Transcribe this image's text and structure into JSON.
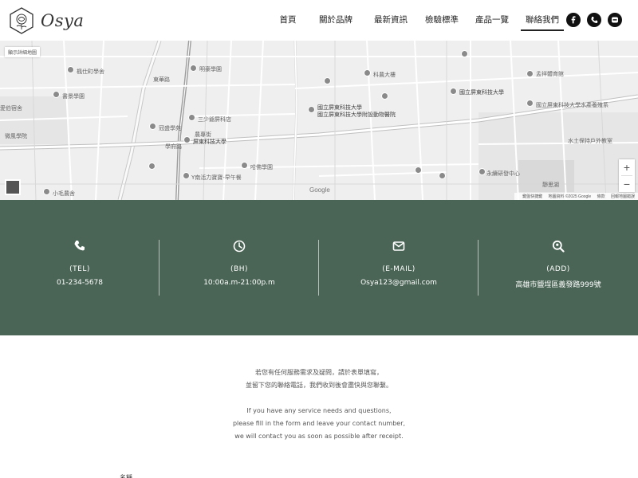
{
  "brand": {
    "name": "Osya"
  },
  "nav": {
    "items": [
      {
        "label": "首頁",
        "name": "nav-home"
      },
      {
        "label": "關於品牌",
        "name": "nav-about"
      },
      {
        "label": "最新資訊",
        "name": "nav-news"
      },
      {
        "label": "檢驗標準",
        "name": "nav-standards"
      },
      {
        "label": "產品一覽",
        "name": "nav-products"
      },
      {
        "label": "聯絡我們",
        "name": "nav-contact"
      }
    ],
    "active": "聯絡我們"
  },
  "socials": [
    {
      "icon": "facebook-icon"
    },
    {
      "icon": "phone-icon"
    },
    {
      "icon": "line-icon"
    }
  ],
  "map": {
    "enlarge_label": "顯示詳細地圖",
    "zoom_in": "+",
    "zoom_out": "−",
    "provider": "Google",
    "attribution": [
      "鍵盤快捷鍵",
      "地圖資料 ©2025 Google",
      "條款",
      "回報地圖錯誤"
    ],
    "labels": [
      "楓仕町學舍",
      "明豪學園",
      "書景學園",
      "三少爺屏科店",
      "冠盛學苑",
      "屏東科技大學",
      "哈佛學園",
      "Y南活力寶寶-早午餐",
      "小毛農舍",
      "微風學院",
      "國立屏東科技大學",
      "國立屏東科技大學附設動物醫院",
      "科農大樓",
      "國立屏東科技大學",
      "孟祥體育館",
      "國立屏東科技大學水產養殖系",
      "水土保持戶外教室",
      "永續研發中心",
      "靜思湖",
      "農專街",
      "學府路",
      "東華路",
      "愛伯宿舍"
    ]
  },
  "contact": [
    {
      "icon": "phone-icon",
      "title": "(TEL)",
      "value": "01-234-5678"
    },
    {
      "icon": "clock-icon",
      "title": "(BH)",
      "value": "10:00a.m-21:00p.m"
    },
    {
      "icon": "mail-icon",
      "title": "(E-MAIL)",
      "value": "Osya123@gmail.com"
    },
    {
      "icon": "search-location-icon",
      "title": "(ADD)",
      "value": "高雄市鹽埕區義發路999號"
    }
  ],
  "intro": {
    "zh_line1": "若您有任何服務需求及疑問，請於表單填寫，",
    "zh_line2": "並留下您的聯絡電話，我們收到後會盡快與您聯繫。",
    "en_line1": "If you have any service needs and questions,",
    "en_line2": "please fill in the form and leave your contact number,",
    "en_line3": "we will contact you as soon as possible after receipt."
  },
  "form": {
    "name_label": "名稱"
  },
  "colors": {
    "band": "#4a6556",
    "text": "#333333",
    "social": "#111111"
  }
}
